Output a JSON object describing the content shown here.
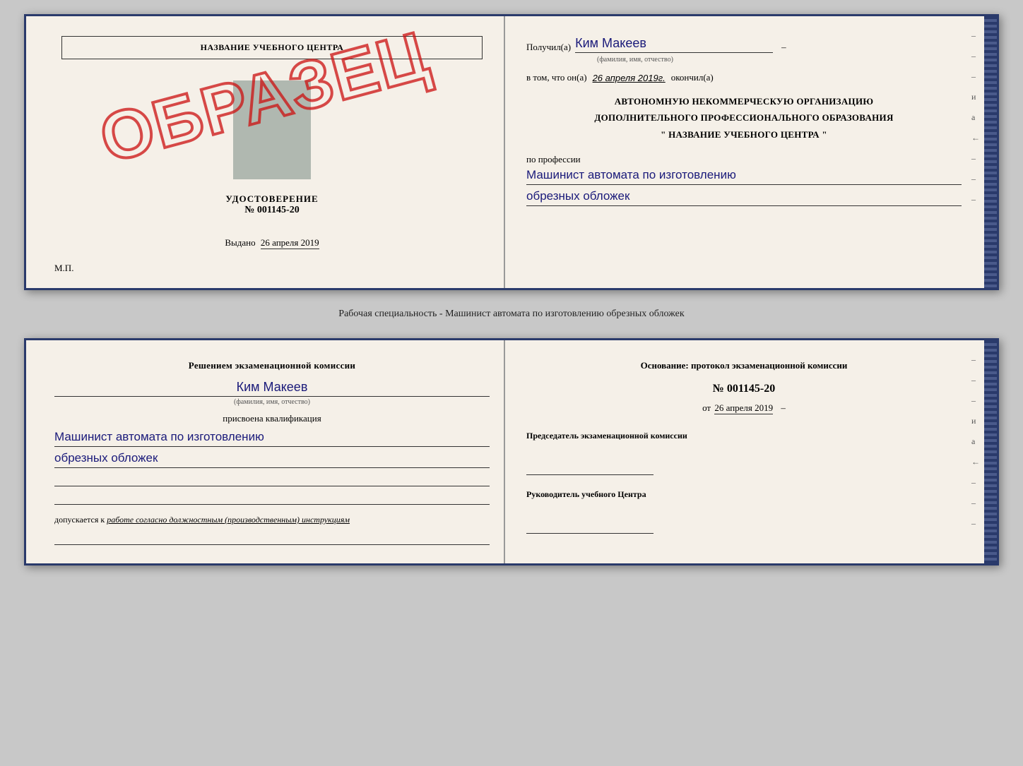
{
  "top_doc": {
    "left": {
      "school_name": "НАЗВАНИЕ УЧЕБНОГО ЦЕНТРА",
      "cert_title": "УДОСТОВЕРЕНИЕ",
      "cert_number": "№ 001145-20",
      "issued_label": "Выдано",
      "issued_date": "26 апреля 2019",
      "mp_label": "М.П.",
      "obrazets": "ОБРАЗЕЦ"
    },
    "right": {
      "recipient_prefix": "Получил(а)",
      "recipient_name": "Ким Макеев",
      "fio_hint": "(фамилия, имя, отчество)",
      "date_prefix": "в том, что он(а)",
      "date_value": "26 апреля 2019г.",
      "date_suffix": "окончил(а)",
      "org_line1": "АВТОНОМНУЮ НЕКОММЕРЧЕСКУЮ ОРГАНИЗАЦИЮ",
      "org_line2": "ДОПОЛНИТЕЛЬНОГО ПРОФЕССИОНАЛЬНОГО ОБРАЗОВАНИЯ",
      "org_line3": "\"  НАЗВАНИЕ УЧЕБНОГО ЦЕНТРА  \"",
      "profession_prefix": "по профессии",
      "profession_line1": "Машинист автомата по изготовлению",
      "profession_line2": "обрезных обложек"
    }
  },
  "middle_caption": "Рабочая специальность - Машинист автомата по изготовлению обрезных обложек",
  "bottom_doc": {
    "left": {
      "commission_text": "Решением экзаменационной комиссии",
      "person_name": "Ким Макеев",
      "fio_hint": "(фамилия, имя, отчество)",
      "qualification_label": "присвоена квалификация",
      "qualification_line1": "Машинист автомата по изготовлению",
      "qualification_line2": "обрезных обложек",
      "allowed_prefix": "допускается к",
      "allowed_italic": "работе согласно должностным (производственным) инструкциям"
    },
    "right": {
      "osnov_label": "Основание: протокол экзаменационной комиссии",
      "protocol_number": "№  001145-20",
      "protocol_date_prefix": "от",
      "protocol_date": "26 апреля 2019",
      "chairman_title": "Председатель экзаменационной комиссии",
      "center_head_title": "Руководитель учебного Центра"
    }
  },
  "dashes_right_top": [
    "-",
    "-",
    "-",
    "и",
    "а",
    "←",
    "-",
    "-",
    "-"
  ],
  "dashes_right_bottom": [
    "-",
    "-",
    "-",
    "и",
    "а",
    "←",
    "-",
    "-",
    "-"
  ]
}
